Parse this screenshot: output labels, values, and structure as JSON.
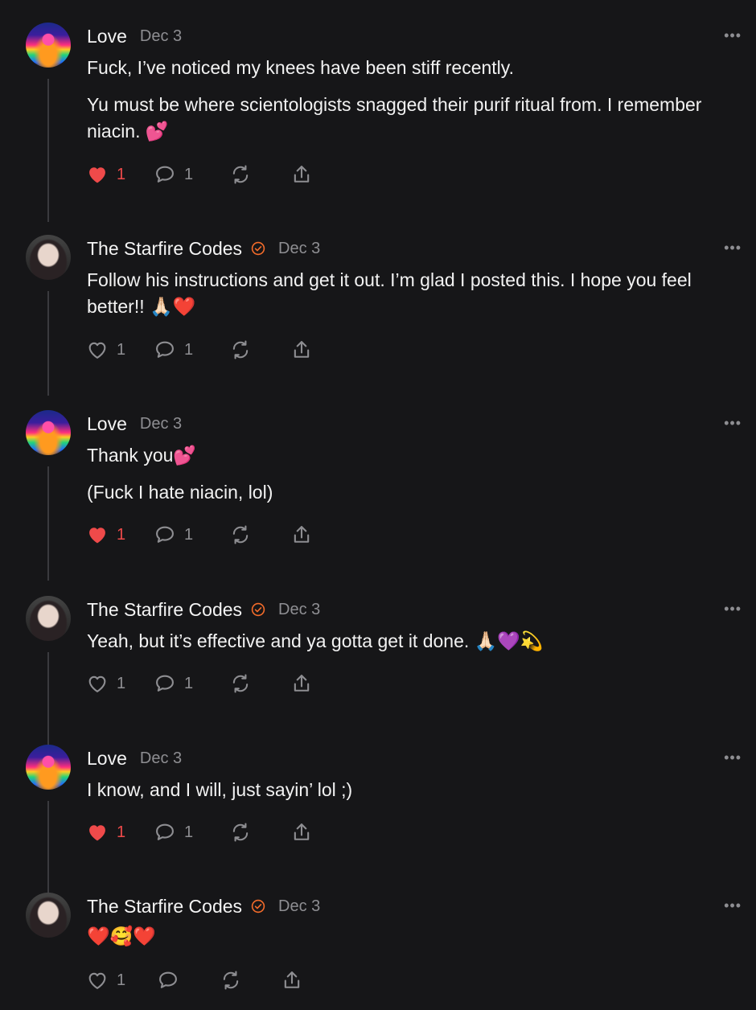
{
  "more_label": "•••",
  "posts": [
    {
      "author": "Love",
      "verified": false,
      "date": "Dec 3",
      "paragraphs": [
        "Fuck, I’ve noticed my knees have been stiff recently.",
        "Yu must be where scientologists snagged their purif ritual from. I remember niacin. 💕"
      ],
      "liked": true,
      "likes": "1",
      "replies": "1"
    },
    {
      "author": "The Starfire Codes",
      "verified": true,
      "date": "Dec 3",
      "paragraphs": [
        "Follow his instructions and get it out. I’m glad I posted this. I hope you feel better!! 🙏🏻❤️"
      ],
      "liked": false,
      "likes": "1",
      "replies": "1"
    },
    {
      "author": "Love",
      "verified": false,
      "date": "Dec 3",
      "paragraphs": [
        "Thank you💕",
        "(Fuck I hate niacin, lol)"
      ],
      "liked": true,
      "likes": "1",
      "replies": "1"
    },
    {
      "author": "The Starfire Codes",
      "verified": true,
      "date": "Dec 3",
      "paragraphs": [
        "Yeah, but it’s effective and ya gotta get it done. 🙏🏻💜💫"
      ],
      "liked": false,
      "likes": "1",
      "replies": "1"
    },
    {
      "author": "Love",
      "verified": false,
      "date": "Dec 3",
      "paragraphs": [
        "I know, and I will, just sayin’ lol ;)"
      ],
      "liked": true,
      "likes": "1",
      "replies": "1"
    },
    {
      "author": "The Starfire Codes",
      "verified": true,
      "date": "Dec 3",
      "paragraphs": [
        "❤️🥰❤️"
      ],
      "liked": false,
      "likes": "1",
      "replies": ""
    }
  ],
  "colors": {
    "like_active": "#ef4a4a",
    "verified": "#f26b2a",
    "muted": "#8e8e92",
    "background": "#161618"
  }
}
